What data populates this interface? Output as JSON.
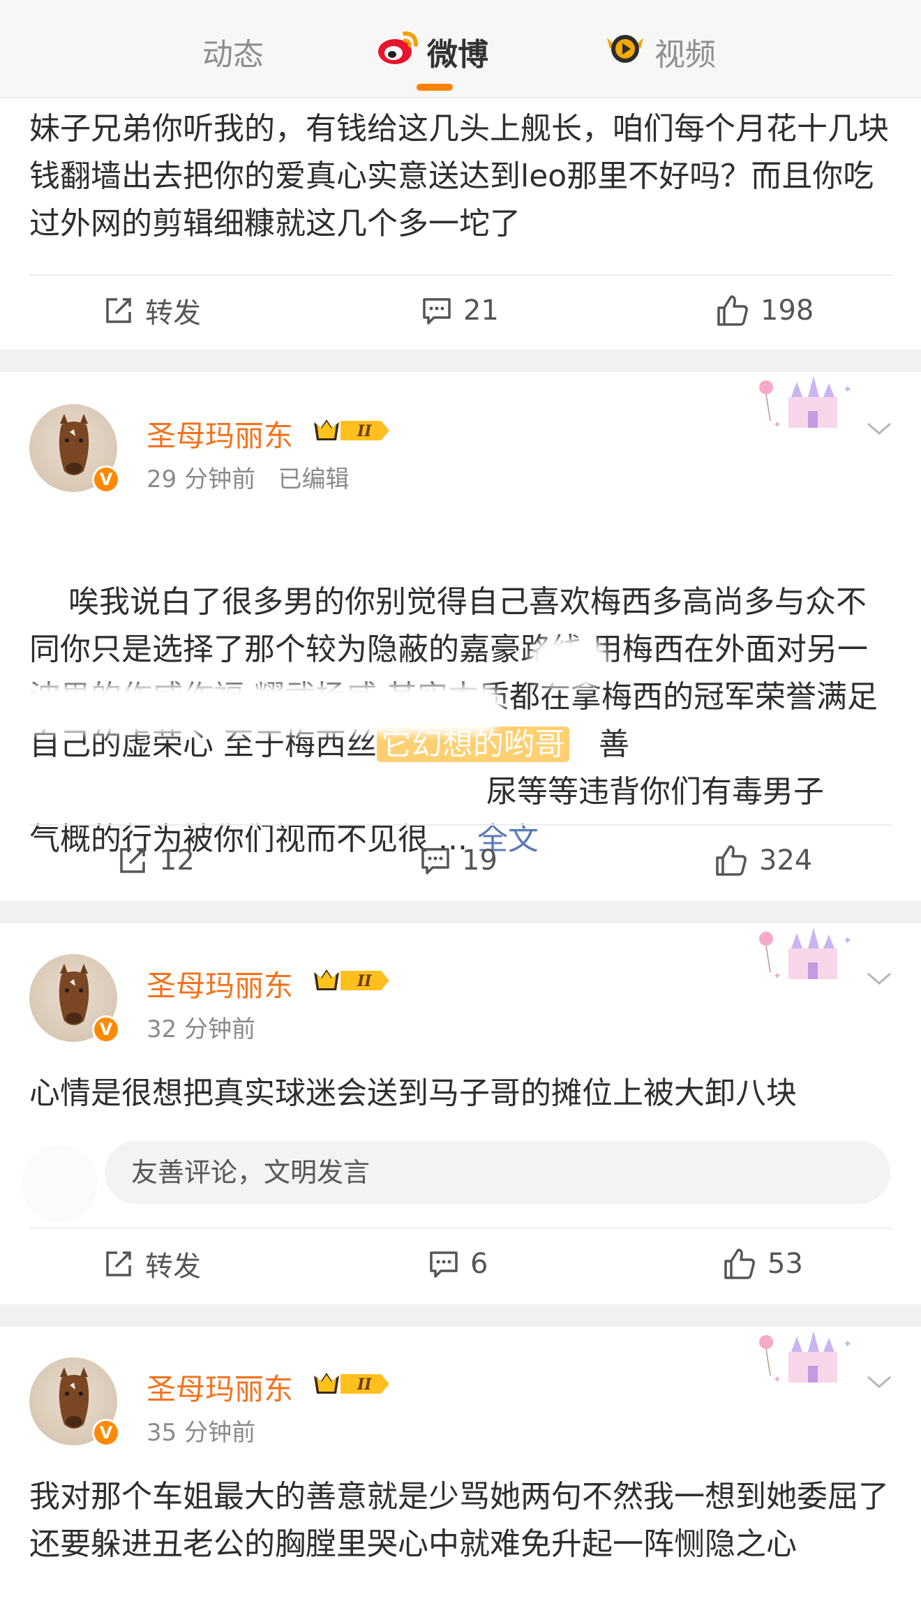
{
  "tabs": [
    {
      "label": "动态",
      "active": false
    },
    {
      "label": "微博",
      "active": true
    },
    {
      "label": "视频",
      "active": false
    }
  ],
  "colors": {
    "accent": "#ff8200",
    "username": "#f4721c",
    "link": "#5b79b8"
  },
  "posts": [
    {
      "text": "妹子兄弟你听我的，有钱给这几头上舰长，咱们每个月花十几块钱翻墙出去把你的爱真心实意送达到leo那里不好吗？而且你吃过外网的剪辑细糠就这几个多一坨了",
      "actions": {
        "repost": "转发",
        "comment": "21",
        "like": "198"
      }
    },
    {
      "username": "圣母玛丽东",
      "level": "II",
      "time": "29 分钟前",
      "edited": "已编辑",
      "text_a": "唉我说白了很多男的你别觉得自己喜欢梅西多高尚多与众不同你只是选择了那个较为隐蔽的嘉豪路线 用梅西在外面对另一波男的作威作福 耀武扬威 其实本质都在拿梅西的冠军荣誉满足自己的虚荣心 至于梅西丝",
      "highlight": "它幻想的哟哥",
      "text_b": "善",
      "text_c": "尿等等违背你们有毒男子",
      "text_d": "气概的行为被你们视而不见很 ... ",
      "more": "全文",
      "actions": {
        "repost": "12",
        "comment": "19",
        "like": "324"
      }
    },
    {
      "username": "圣母玛丽东",
      "level": "II",
      "time": "32 分钟前",
      "text": "心情是很想把真实球迷会送到马子哥的摊位上被大卸八块",
      "comment_placeholder": "友善评论，文明发言",
      "actions": {
        "repost": "转发",
        "comment": "6",
        "like": "53"
      }
    },
    {
      "username": "圣母玛丽东",
      "level": "II",
      "time": "35 分钟前",
      "text": "我对那个车姐最大的善意就是少骂她两句不然我一想到她委屈了还要躲进丑老公的胸膛里哭心中就难免升起一阵恻隐之心"
    }
  ],
  "icons": {
    "repost": "repost-icon",
    "comment": "comment-icon",
    "like": "like-icon",
    "weibo": "weibo-logo-icon",
    "video": "video-logo-icon",
    "verified": "verified-badge-icon",
    "chevron": "chevron-down-icon"
  }
}
